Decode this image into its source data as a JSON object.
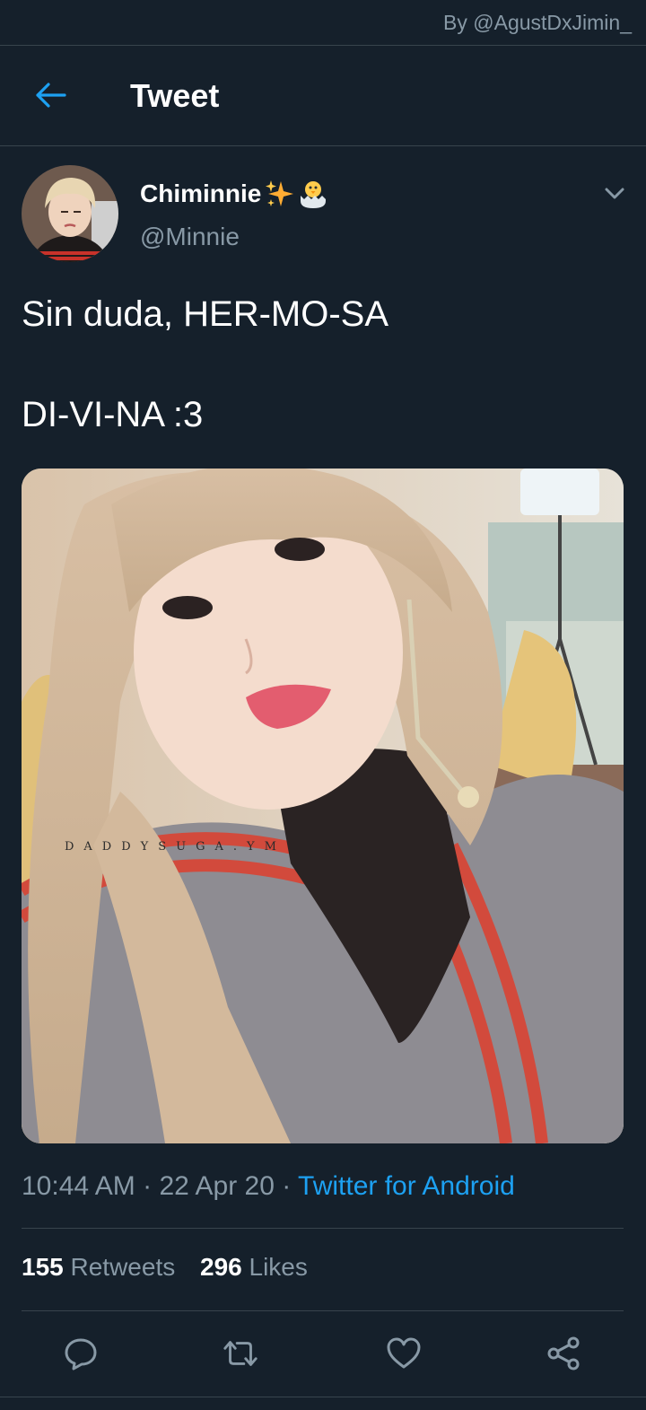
{
  "credit": "By @AgustDxJimin_",
  "header": {
    "title": "Tweet"
  },
  "tweet": {
    "display_name": "Chiminnie",
    "handle": "@Minnie",
    "text_lines": [
      "Sin duda, HER-MO-SA",
      "DI-VI-NA :3"
    ],
    "watermark": "DADDYSUGA.YM",
    "time": "10:44 AM",
    "date": "22 Apr 20",
    "source": "Twitter for Android",
    "separator": "·",
    "retweets_count": "155",
    "retweets_label": "Retweets",
    "likes_count": "296",
    "likes_label": "Likes"
  },
  "icons": {
    "back": "back-arrow-icon",
    "caret": "chevron-down-icon",
    "reply": "reply-icon",
    "retweet": "retweet-icon",
    "like": "heart-icon",
    "share": "share-icon"
  },
  "colors": {
    "background": "#15202b",
    "accent": "#1da1f2",
    "secondary_text": "#8899a6",
    "divider": "#38444d"
  }
}
